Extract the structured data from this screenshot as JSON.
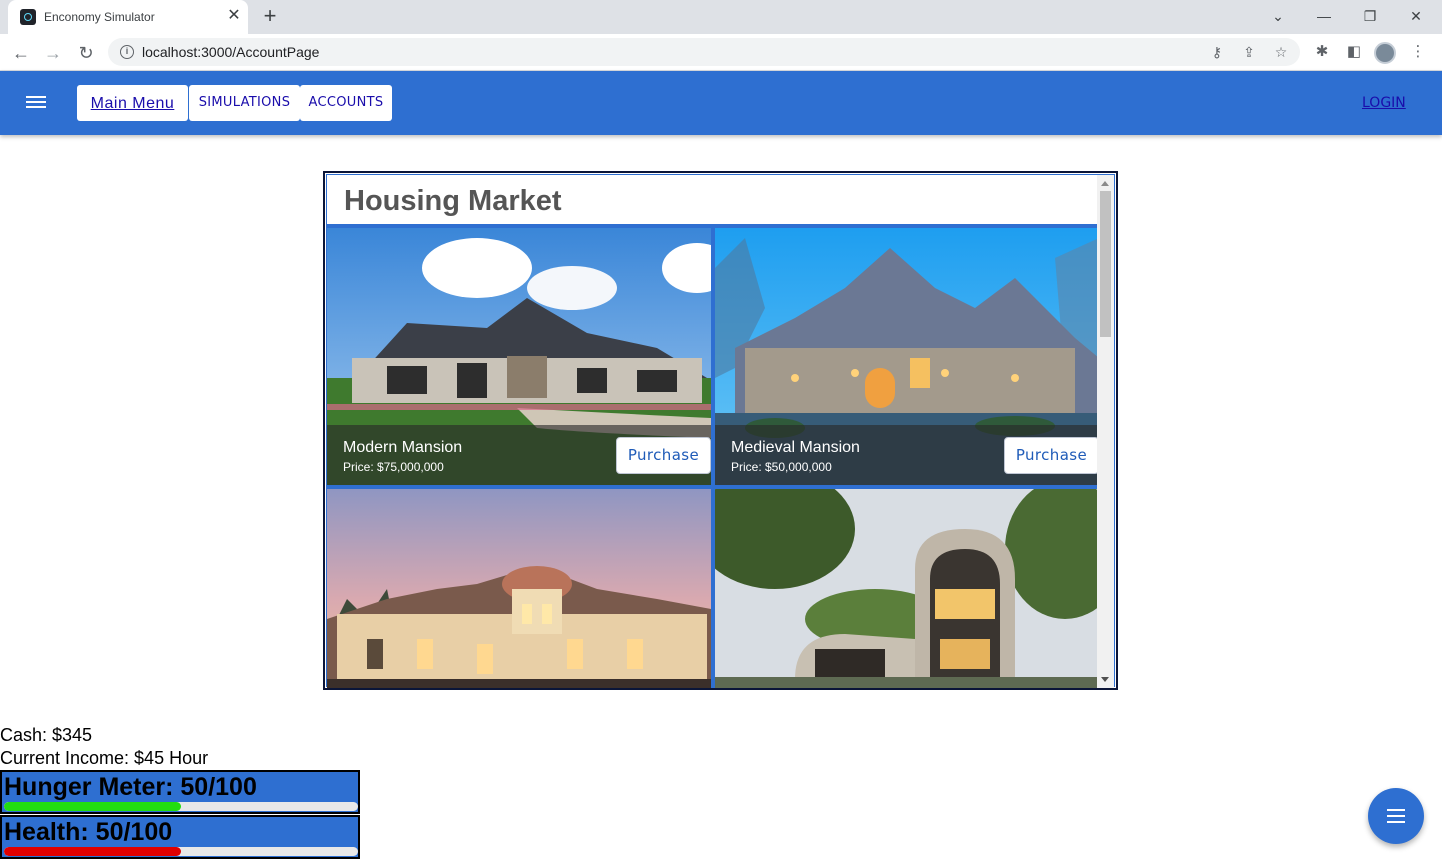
{
  "browser": {
    "tab_title": "Enconomy Simulator",
    "url": "localhost:3000/AccountPage"
  },
  "appbar": {
    "main_menu": "Main Menu",
    "simulations": "SIMULATIONS",
    "accounts": "ACCOUNTS",
    "login": "LOGIN",
    "color": "#2e6fd1"
  },
  "market": {
    "title": "Housing Market",
    "houses": [
      {
        "name": "Modern Mansion",
        "price": "Price: $75,000,000",
        "button": "Purchase"
      },
      {
        "name": "Medieval Mansion",
        "price": "Price: $50,000,000",
        "button": "Purchase"
      }
    ]
  },
  "stats": {
    "cash": "Cash: $345",
    "income": "Current Income: $45 Hour",
    "hunger": {
      "label": "Hunger Meter: 50/100",
      "value": 50,
      "max": 100,
      "color": "#22dd11"
    },
    "health": {
      "label": "Health: 50/100",
      "value": 50,
      "max": 100,
      "color": "#e00000"
    }
  }
}
